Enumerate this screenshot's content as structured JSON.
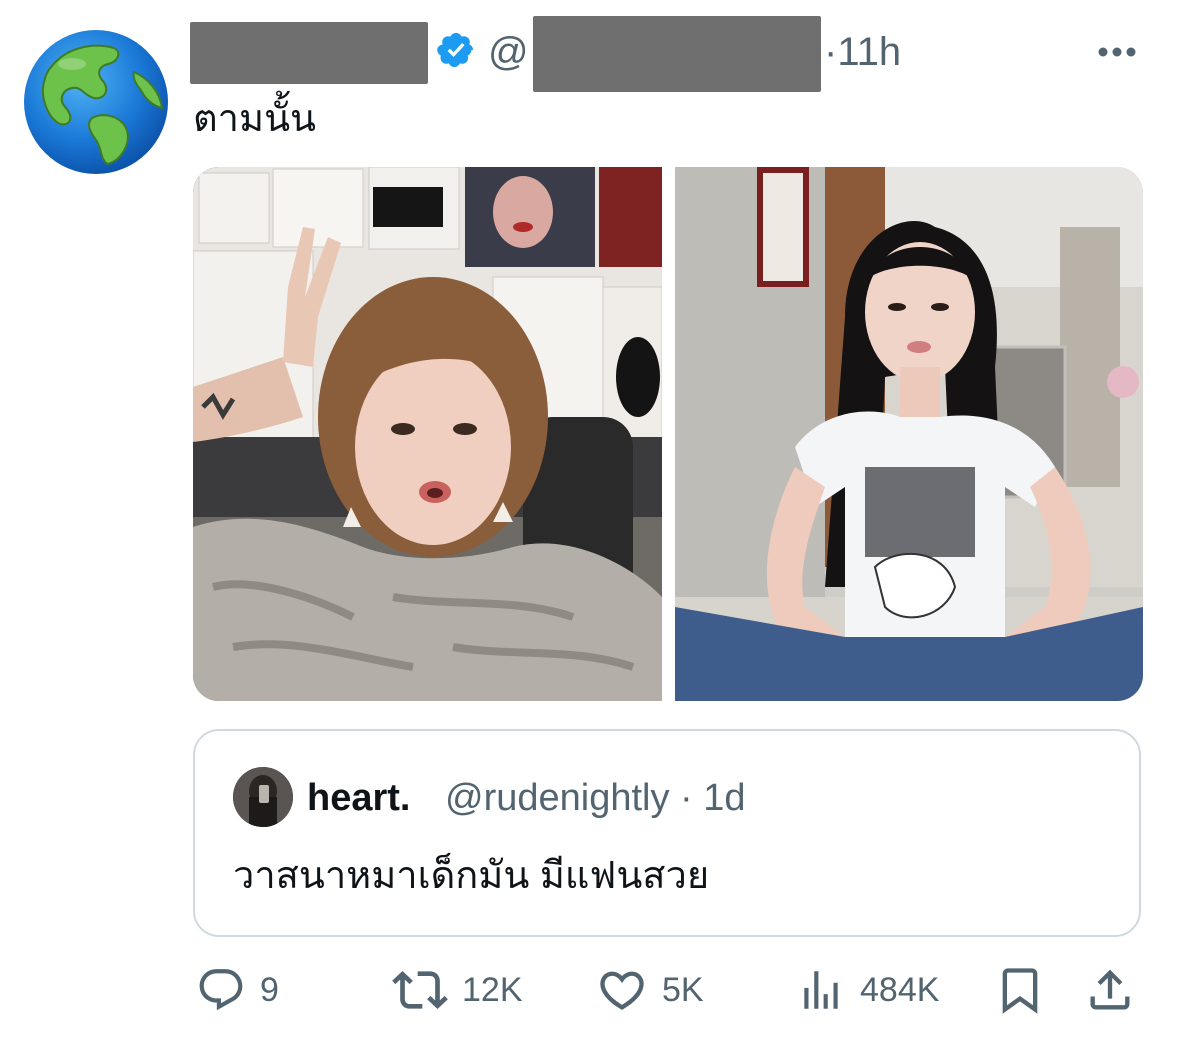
{
  "tweet": {
    "handle_prefix": "@",
    "time": "·11h",
    "text": "ตามนั้น",
    "more_icon": "more-dots-icon",
    "verified_icon": "verified-badge-icon",
    "accent_color": "#1d9bf0"
  },
  "quote": {
    "name": "heart.",
    "handle": "@rudenightly · 1d",
    "text": "วาสนาหมาเด็กมัน มีแฟนสวย"
  },
  "actions": {
    "reply_count": "9",
    "retweet_count": "12K",
    "like_count": "5K",
    "views_count": "484K"
  }
}
